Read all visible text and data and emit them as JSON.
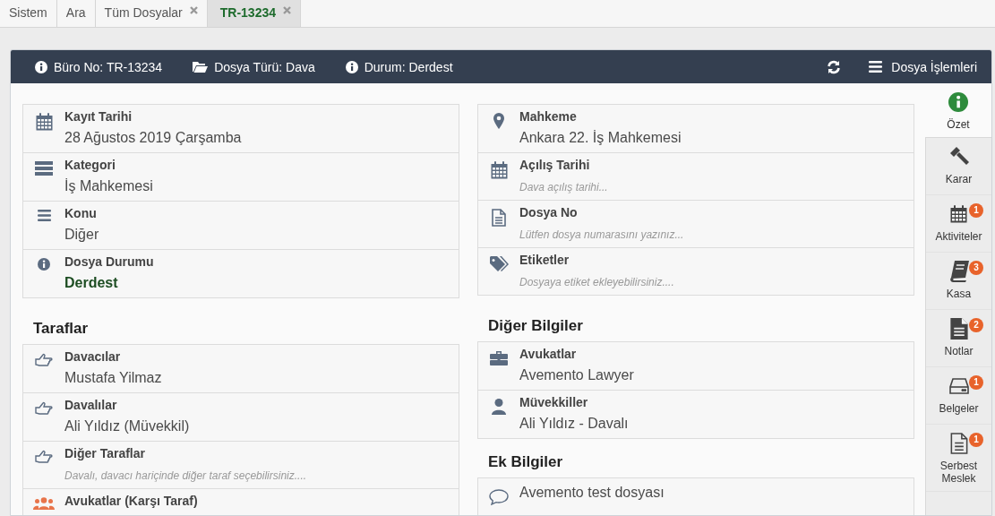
{
  "tabs": [
    {
      "label": "Sistem",
      "closable": false,
      "selected": false
    },
    {
      "label": "Ara",
      "closable": false,
      "selected": false
    },
    {
      "label": "Tüm Dosyalar",
      "closable": true,
      "selected": false
    },
    {
      "label": "TR-13234",
      "closable": true,
      "selected": true
    }
  ],
  "header": {
    "items": [
      {
        "label": "Büro No: TR-13234"
      },
      {
        "label": "Dosya Türü: Dava"
      },
      {
        "label": "Durum: Derdest"
      }
    ],
    "menu": "Dosya İşlemleri"
  },
  "columns": [
    {
      "blocks": [
        {
          "rows": [
            {
              "kind": "value",
              "label": "Kayıt Tarihi",
              "value": "28 Ağustos 2019 Çarşamba"
            },
            {
              "kind": "value",
              "label": "Kategori",
              "value": "İş Mahkemesi"
            },
            {
              "kind": "value",
              "label": "Konu",
              "value": "Diğer"
            },
            {
              "kind": "status",
              "label": "Dosya Durumu",
              "value": "Derdest"
            }
          ]
        },
        {
          "title": "Taraflar",
          "rows": [
            {
              "kind": "value",
              "label": "Davacılar",
              "value": "Mustafa Yilmaz"
            },
            {
              "kind": "value",
              "label": "Davalılar",
              "value": "Ali Yıldız (Müvekkil)"
            },
            {
              "kind": "placeholder",
              "label": "Diğer Taraflar",
              "placeholder": "Davalı, davacı hariçinde diğer taraf seçebilirsiniz...."
            },
            {
              "kind": "label",
              "label": "Avukatlar (Karşı Taraf)"
            }
          ]
        }
      ]
    },
    {
      "blocks": [
        {
          "rows": [
            {
              "kind": "value",
              "label": "Mahkeme",
              "value": "Ankara 22. İş Mahkemesi"
            },
            {
              "kind": "placeholder",
              "label": "Açılış Tarihi",
              "placeholder": "Dava açılış tarihi..."
            },
            {
              "kind": "placeholder",
              "label": "Dosya No",
              "placeholder": "Lütfen dosya numarasını yazınız..."
            },
            {
              "kind": "placeholder",
              "label": "Etiketler",
              "placeholder": "Dosyaya etiket ekleyebilirsiniz...."
            }
          ]
        },
        {
          "title": "Diğer Bilgiler",
          "rows": [
            {
              "kind": "value",
              "label": "Avukatlar",
              "value": "Avemento Lawyer"
            },
            {
              "kind": "value",
              "label": "Müvekkiller",
              "value": "Ali Yıldız - Davalı"
            }
          ]
        },
        {
          "title": "Ek Bilgiler",
          "rows": [
            {
              "kind": "note",
              "value": "Avemento test dosyası"
            }
          ]
        }
      ]
    }
  ],
  "sidenav": [
    {
      "label": "Özet",
      "selected": true
    },
    {
      "label": "Karar",
      "selected": false
    },
    {
      "label": "Aktiviteler",
      "badge": "1",
      "selected": false
    },
    {
      "label": "Kasa",
      "badge": "3",
      "selected": false
    },
    {
      "label": "Notlar",
      "badge": "2",
      "selected": false
    },
    {
      "label": "Belgeler",
      "badge": "1",
      "selected": false
    },
    {
      "label": "Serbest Meslek",
      "badge": "1",
      "selected": false
    }
  ]
}
